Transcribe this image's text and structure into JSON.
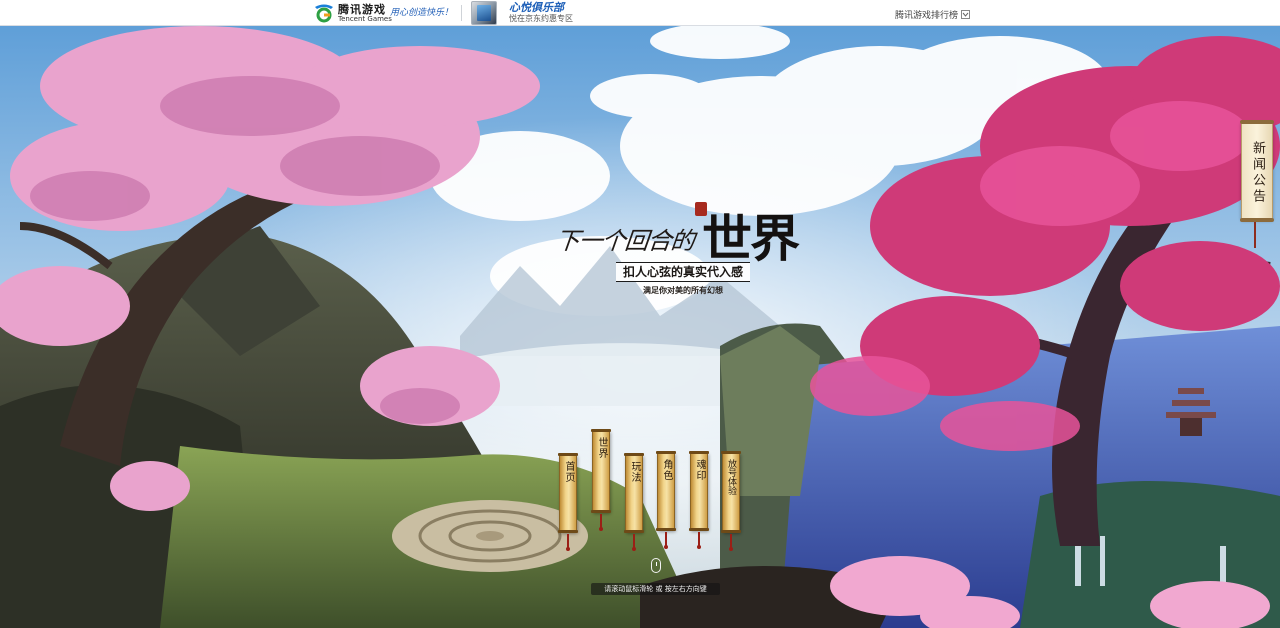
{
  "topbar": {
    "brand_cn": "腾讯游戏",
    "brand_en": "Tencent Games",
    "slogan": "用心创造快乐！",
    "promo_title": "心悦俱乐部",
    "promo_sub": "悦在京东约惠专区",
    "rank_link": "腾讯游戏排行榜"
  },
  "hero": {
    "headline_small": "下一个回合的",
    "headline_big": "世界",
    "subtitle": "扣人心弦的真实代入感",
    "tagline": "满足你对美的所有幻想"
  },
  "news_tab": {
    "label": "新闻公告"
  },
  "nav": {
    "items": [
      {
        "label": "首页"
      },
      {
        "label": "世界"
      },
      {
        "label": "玩法"
      },
      {
        "label": "角色"
      },
      {
        "label": "魂印"
      },
      {
        "label": "放号体验"
      }
    ]
  },
  "hint": "请滚动鼠标滑轮 或 按左右方向键",
  "colors": {
    "sky_top": "#5f9fd8",
    "blossom_pink": "#e79ac9",
    "blossom_magenta": "#cf3a78",
    "scroll_gold": "#f2d58b",
    "tassel_red": "#9b1f16"
  },
  "icons": {
    "brand_logo": "tencent-games-logo-icon",
    "rank_caret": "chevron-down-icon",
    "mouse": "mouse-scroll-icon"
  }
}
